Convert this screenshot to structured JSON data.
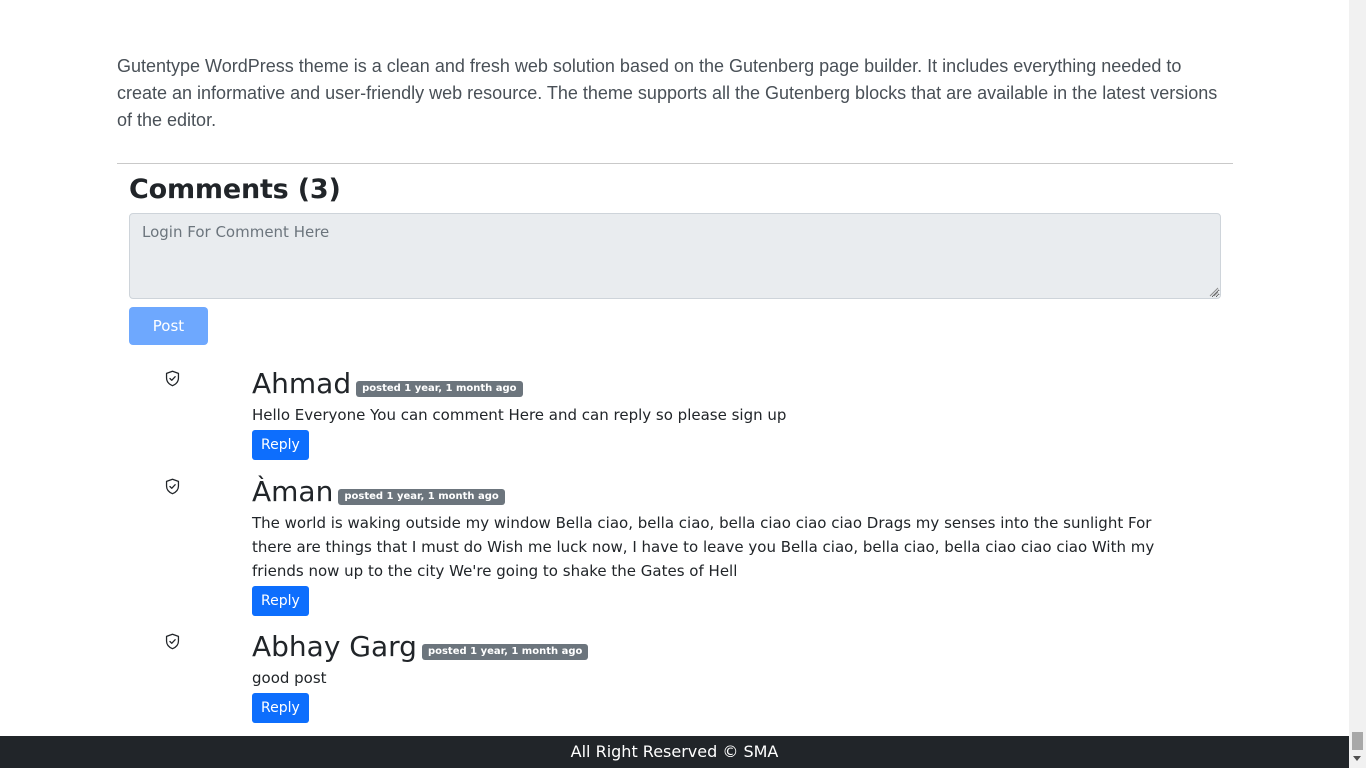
{
  "intro_text": "Gutentype WordPress theme is a clean and fresh web solution based on the Gutenberg page builder. It includes everything needed to create an informative and user-friendly web resource. The theme supports all the Gutenberg blocks that are available in the latest versions of the editor.",
  "comments_section": {
    "title": "Comments (3)",
    "input_placeholder": "Login For Comment Here",
    "input_value": "",
    "post_label": "Post"
  },
  "comments": [
    {
      "author": "Ahmad",
      "badge": "posted 1 year, 1 month ago",
      "text": "Hello Everyone You can comment Here and can reply so please sign up",
      "reply_label": "Reply",
      "icon": "shield-check-icon"
    },
    {
      "author": "Àman",
      "badge": "posted 1 year, 1 month ago",
      "text": "The world is waking outside my window Bella ciao, bella ciao, bella ciao ciao ciao Drags my senses into the sunlight For there are things that I must do Wish me luck now, I have to leave you Bella ciao, bella ciao, bella ciao ciao ciao With my friends now up to the city We're going to shake the Gates of Hell",
      "reply_label": "Reply",
      "icon": "shield-check-icon"
    },
    {
      "author": "Abhay Garg",
      "badge": "posted 1 year, 1 month ago",
      "text": "good post",
      "reply_label": "Reply",
      "icon": "shield-check-icon"
    }
  ],
  "footer": {
    "text": "All Right Reserved © SMA"
  },
  "colors": {
    "primary": "#0d6efd",
    "primary_disabled": "#6ea8fe",
    "badge": "#6c757d",
    "footer_bg": "#212529",
    "input_bg": "#e9ecef"
  }
}
